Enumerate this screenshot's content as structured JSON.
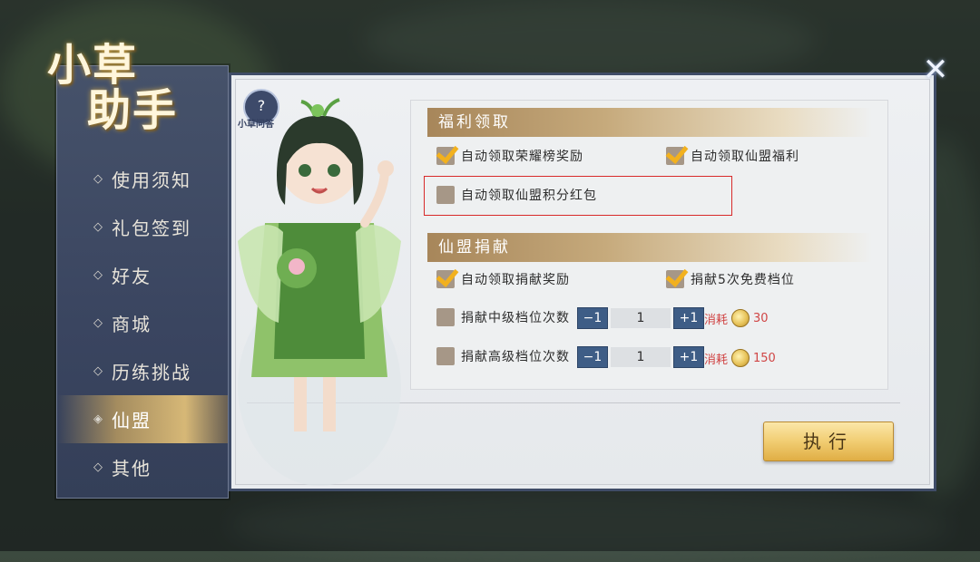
{
  "app": {
    "logo_line1": "小草",
    "logo_line2": "助手"
  },
  "sidebar": {
    "items": [
      {
        "label": "使用须知",
        "active": false
      },
      {
        "label": "礼包签到",
        "active": false
      },
      {
        "label": "好友",
        "active": false
      },
      {
        "label": "商城",
        "active": false
      },
      {
        "label": "历练挑战",
        "active": false
      },
      {
        "label": "仙盟",
        "active": true
      },
      {
        "label": "其他",
        "active": false
      }
    ]
  },
  "header": {
    "qa_label": "小草问答",
    "close_symbol": "✕"
  },
  "welfare": {
    "title": "福利领取",
    "options": [
      {
        "label": "自动领取荣耀榜奖励",
        "checked": true
      },
      {
        "label": "自动领取仙盟福利",
        "checked": true
      },
      {
        "label": "自动领取仙盟积分红包",
        "checked": false
      }
    ]
  },
  "donation": {
    "title": "仙盟捐献",
    "options": [
      {
        "label": "自动领取捐献奖励",
        "checked": true
      },
      {
        "label": "捐献5次免费档位",
        "checked": true
      }
    ],
    "mid": {
      "label": "捐献中级档位次数",
      "checked": false,
      "minus": "−1",
      "value": "1",
      "plus": "+1",
      "cost_label": "消耗",
      "cost": "30"
    },
    "high": {
      "label": "捐献高级档位次数",
      "checked": false,
      "minus": "−1",
      "value": "1",
      "plus": "+1",
      "cost_label": "消耗",
      "cost": "150"
    }
  },
  "actions": {
    "execute_label": "执行"
  },
  "colors": {
    "accent_gold": "#f1cd72",
    "highlight_red": "#d82a2a",
    "stepper_blue": "#3e5d86",
    "cost_red": "#d04545"
  },
  "icons": {
    "qa": "question-doc-icon",
    "close": "close-icon",
    "coin": "coin-icon",
    "check": "checkmark-icon"
  }
}
